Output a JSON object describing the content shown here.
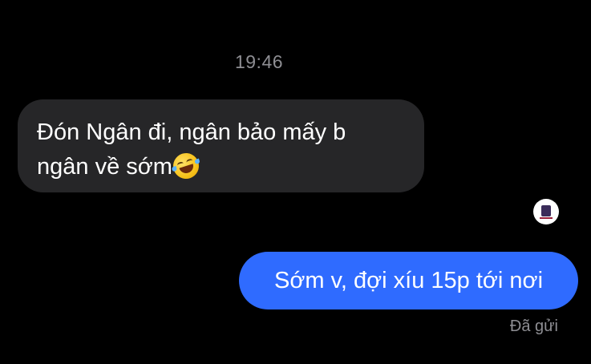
{
  "conversation": {
    "timestamp": "19:46",
    "incoming_message": {
      "line1": "Đón Ngân đi, ngân bảo mấy b",
      "line2": "ngân về sớm",
      "emoji": "rolling-on-floor-laughing-icon"
    },
    "outgoing_message": {
      "text": "Sớm v, đợi xíu 15p tới nơi",
      "status": "Đã gửi"
    },
    "avatar_icon": "contact-avatar-icon"
  },
  "colors": {
    "background": "#000000",
    "incoming_bubble": "#262628",
    "outgoing_bubble": "#2f6bff",
    "secondary_text": "#8e8e93",
    "primary_text": "#ffffff"
  }
}
